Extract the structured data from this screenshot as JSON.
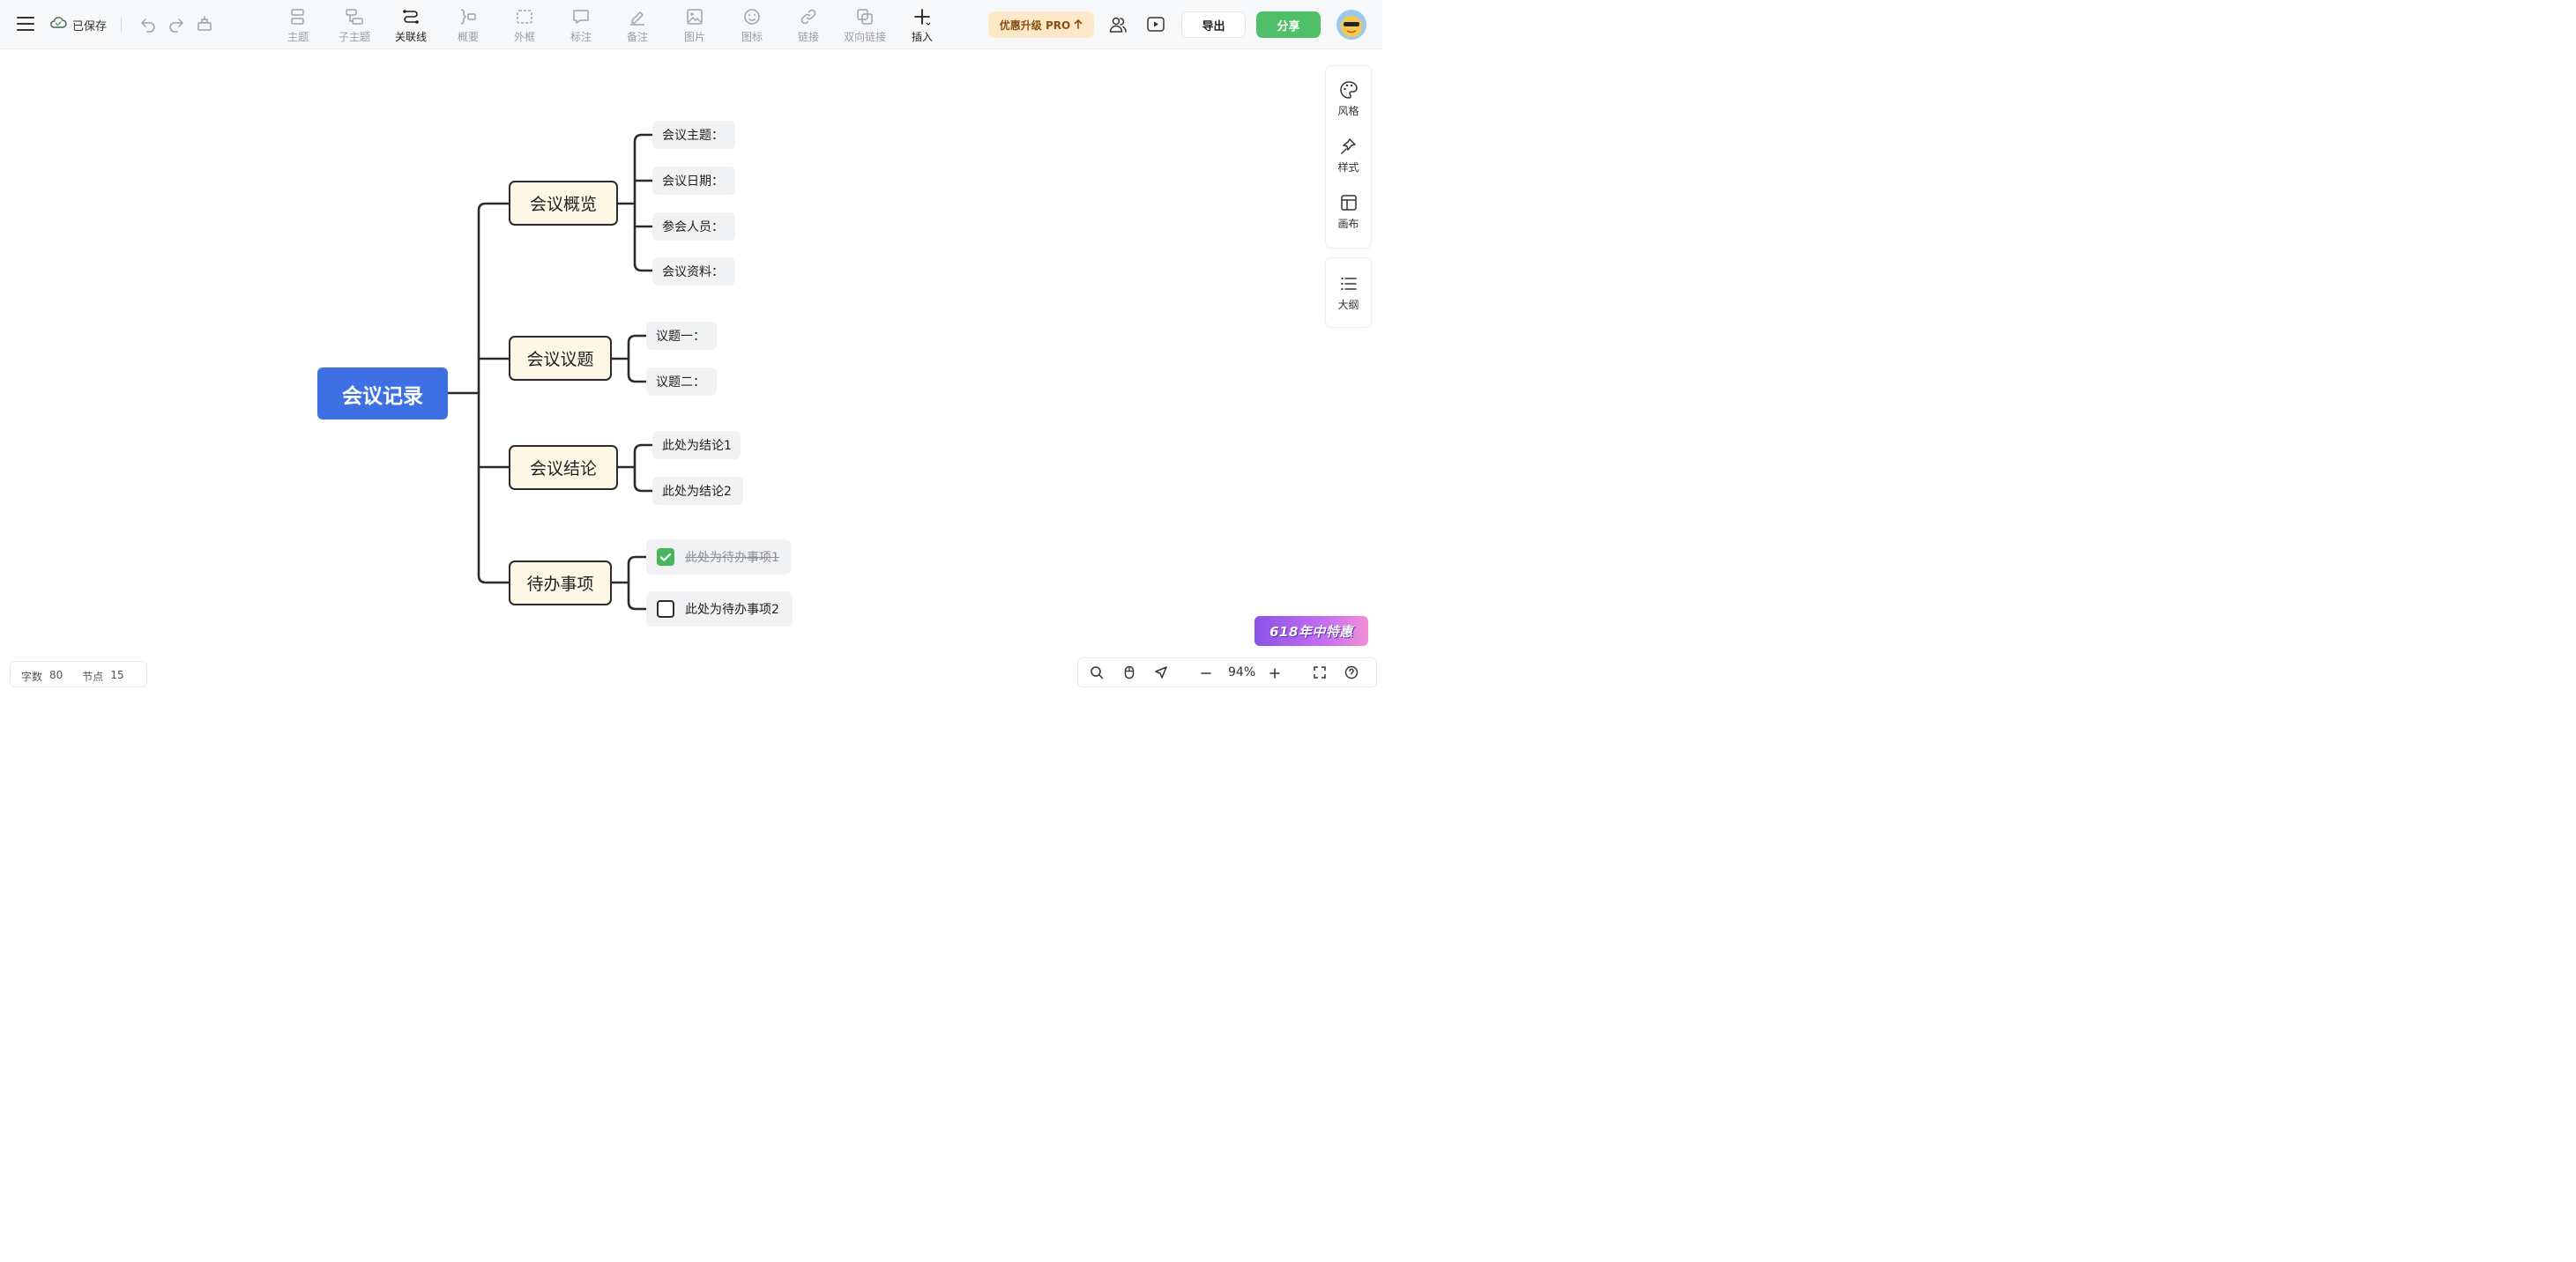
{
  "header": {
    "save_status": "已保存",
    "tools": [
      {
        "label": "主题",
        "icon": "topic-icon",
        "active": false
      },
      {
        "label": "子主题",
        "icon": "subtopic-icon",
        "active": false
      },
      {
        "label": "关联线",
        "icon": "relation-line-icon",
        "active": true
      },
      {
        "label": "概要",
        "icon": "summary-icon",
        "active": false
      },
      {
        "label": "外框",
        "icon": "boundary-icon",
        "active": false
      },
      {
        "label": "标注",
        "icon": "callout-icon",
        "active": false
      },
      {
        "label": "备注",
        "icon": "note-icon",
        "active": false
      },
      {
        "label": "图片",
        "icon": "image-icon",
        "active": false
      },
      {
        "label": "图标",
        "icon": "emoji-icon",
        "active": false
      },
      {
        "label": "链接",
        "icon": "link-icon",
        "active": false
      },
      {
        "label": "双向链接",
        "icon": "bidirectional-link-icon",
        "active": false
      },
      {
        "label": "插入",
        "icon": "plus-icon",
        "active": true
      }
    ],
    "pro_label": "优惠升级 PRO",
    "export_label": "导出",
    "share_label": "分享"
  },
  "side_panel": {
    "items": [
      {
        "label": "风格",
        "icon": "palette-icon"
      },
      {
        "label": "样式",
        "icon": "style-icon"
      },
      {
        "label": "画布",
        "icon": "canvas-layout-icon"
      }
    ],
    "outline_label": "大纲"
  },
  "mindmap": {
    "root": "会议记录",
    "branches": [
      {
        "title": "会议概览",
        "children": [
          "会议主题：",
          "会议日期：",
          "参会人员：",
          "会议资料："
        ]
      },
      {
        "title": "会议议题",
        "children": [
          "议题一：",
          "议题二："
        ]
      },
      {
        "title": "会议结论",
        "children": [
          "此处为结论1",
          "此处为结论2"
        ]
      },
      {
        "title": "待办事项",
        "tasks": [
          {
            "text": "此处为待办事项1",
            "done": true
          },
          {
            "text": "此处为待办事项2",
            "done": false
          }
        ]
      }
    ]
  },
  "footer": {
    "word_count_label": "字数",
    "word_count": "80",
    "node_count_label": "节点",
    "node_count": "15",
    "zoom": "94%",
    "promo_text": "618年中特惠"
  },
  "colors": {
    "root": "#3d70e3",
    "branch_fill": "#fdf8e5",
    "leaf_fill": "#f1f2f4",
    "share": "#4fbf68",
    "pro": "#fde8c8"
  }
}
